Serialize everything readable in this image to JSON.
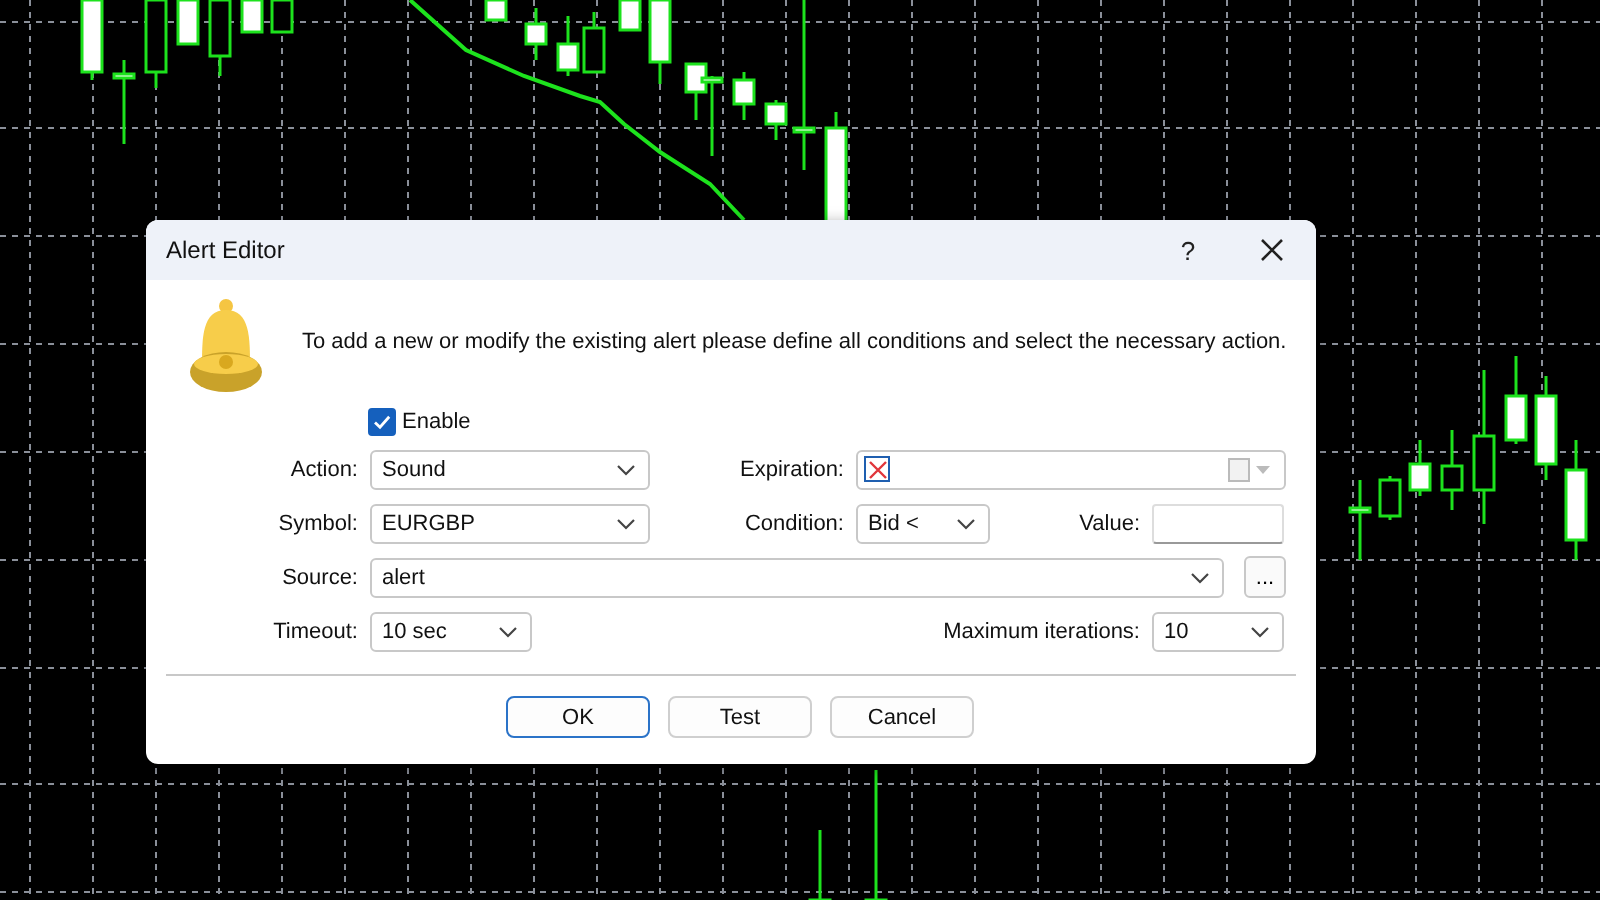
{
  "window": {
    "title": "Alert Editor",
    "help": "?"
  },
  "message": "To add a new or modify the existing alert please define all conditions and select the necessary action.",
  "enable": {
    "label": "Enable",
    "checked": true
  },
  "rows": [
    [
      {
        "label": "Action:",
        "kind": "combo",
        "value": "Sound"
      },
      {
        "label": "Expiration:",
        "kind": "date",
        "no_expiration": true
      }
    ],
    [
      {
        "label": "Symbol:",
        "kind": "combo",
        "value": "EURGBP"
      },
      {
        "label": "Condition:",
        "kind": "combo",
        "value": "Bid <"
      },
      {
        "label": "Value:",
        "kind": "text"
      }
    ],
    [
      {
        "label": "Source:",
        "kind": "combo",
        "value": "alert"
      },
      {
        "kind": "browse",
        "text": "..."
      }
    ],
    [
      {
        "label": "Timeout:",
        "kind": "combo",
        "value": "10 sec"
      },
      {
        "label": "Maximum iterations:",
        "kind": "combo",
        "value": "10"
      }
    ]
  ],
  "buttons": [
    {
      "label": "OK",
      "default": true
    },
    {
      "label": "Test",
      "default": false
    },
    {
      "label": "Cancel",
      "default": false
    }
  ]
}
